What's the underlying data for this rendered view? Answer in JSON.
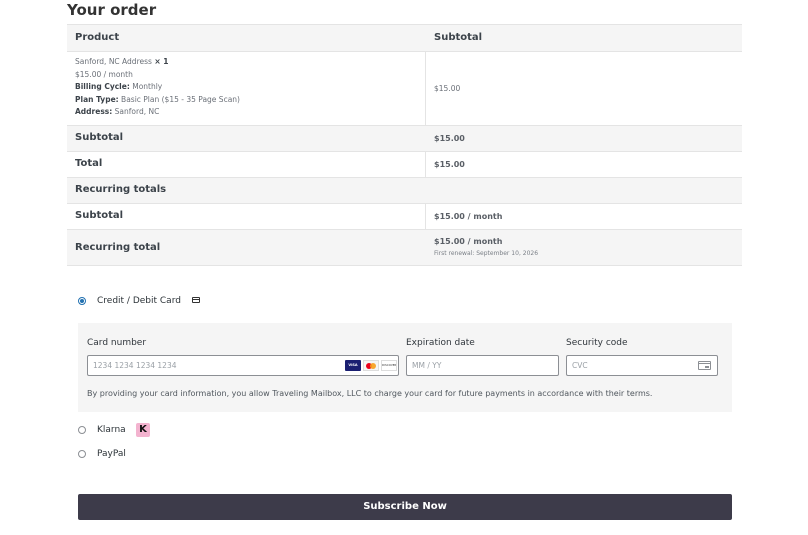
{
  "order": {
    "heading": "Your order",
    "col_product": "Product",
    "col_subtotal": "Subtotal",
    "item": {
      "name": "Sanford, NC Address",
      "qty": "× 1",
      "price_line": "$15.00 / month",
      "billing_cycle_label": "Billing Cycle:",
      "billing_cycle_value": "Monthly",
      "plan_type_label": "Plan Type:",
      "plan_type_value": "Basic Plan ($15 - 35 Page Scan)",
      "address_label": "Address:",
      "address_value": "Sanford, NC",
      "subtotal": "$15.00"
    },
    "subtotal_label": "Subtotal",
    "subtotal_value": "$15.00",
    "total_label": "Total",
    "total_value": "$15.00",
    "recurring_heading": "Recurring totals",
    "recurring_subtotal_label": "Subtotal",
    "recurring_subtotal_value": "$15.00 / month",
    "recurring_total_label": "Recurring total",
    "recurring_total_value": "$15.00 / month",
    "first_renewal": "First renewal: September 10, 2026"
  },
  "payment": {
    "methods": [
      {
        "label": "Credit / Debit Card",
        "selected": true,
        "icon": "card-icon"
      },
      {
        "label": "Klarna",
        "selected": false,
        "icon": "klarna-logo"
      },
      {
        "label": "PayPal",
        "selected": false
      }
    ],
    "klarna_letter": "K",
    "card_number_label": "Card number",
    "card_number_placeholder": "1234 1234 1234 1234",
    "card_brands": [
      "VISA",
      "mastercard",
      "DISCOVER"
    ],
    "expiration_label": "Expiration date",
    "expiration_placeholder": "MM / YY",
    "security_label": "Security code",
    "security_placeholder": "CVC",
    "consent": "By providing your card information, you allow Traveling Mailbox, LLC to charge your card for future payments in accordance with their terms."
  },
  "subscribe_label": "Subscribe Now",
  "colors": {
    "accent": "#2271b1",
    "button": "#3d3b4a",
    "klarna": "#f3b3cf"
  }
}
